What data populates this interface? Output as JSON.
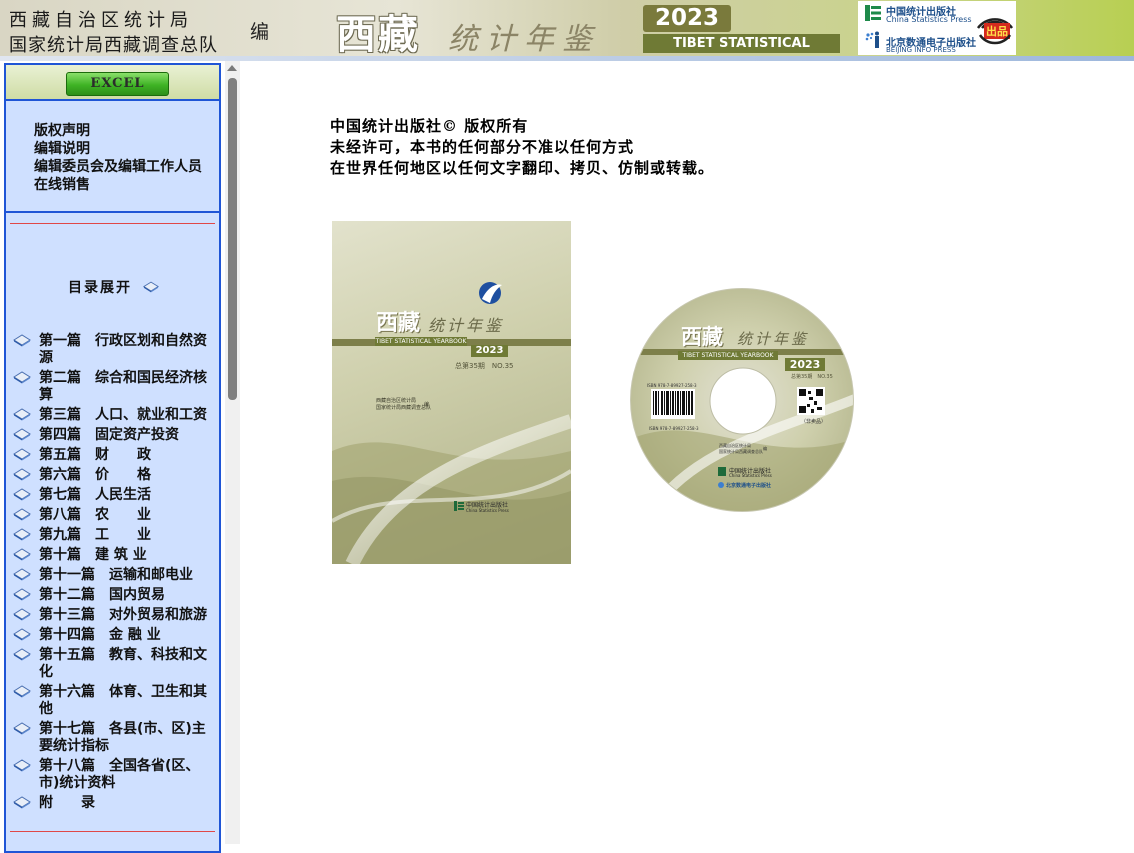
{
  "banner": {
    "org_line1": "西藏自治区统计局",
    "org_line2": "国家统计局西藏调查总队",
    "editor_tag": "编",
    "title_big": "西藏",
    "title_small": "统计年鉴",
    "year": "2023",
    "title_en": "TIBET STATISTICAL YEARBOOK",
    "press1_cn": "中国统计出版社",
    "press1_en": "China Statistics Press",
    "press2_cn": "北京数通电子出版社",
    "press2_en": "BEIJING INFO PRESS",
    "stamp_text": "出品"
  },
  "sidebar": {
    "excel_label": "EXCEL",
    "info_links": [
      "版权声明",
      "编辑说明",
      "编辑委员会及编辑工作人员",
      "在线销售"
    ],
    "toc_toggle": "目录展开",
    "toc": [
      "第一篇　行政区划和自然资源",
      "第二篇　综合和国民经济核算",
      "第三篇　人口、就业和工资",
      "第四篇　固定资产投资",
      "第五篇　财　　政",
      "第六篇　价　　格",
      "第七篇　人民生活",
      "第八篇　农　　业",
      "第九篇　工　　业",
      "第十篇　建 筑 业",
      "第十一篇　运输和邮电业",
      "第十二篇　国内贸易",
      "第十三篇　对外贸易和旅游",
      "第十四篇　金 融 业",
      "第十五篇　教育、科技和文化",
      "第十六篇　体育、卫生和其他",
      "第十七篇　各县(市、区)主要统计指标",
      "第十八篇　全国各省(区、市)统计资料",
      "附　　录"
    ]
  },
  "main": {
    "copyright_lines": [
      "中国统计出版社© 版权所有",
      "未经许可，本书的任何部分不准以任何方式",
      "在世界任何地区以任何文字翻印、拷贝、仿制或转载。"
    ],
    "cover": {
      "title_big": "西藏",
      "title_small": "统计年鉴",
      "title_en": "TIBET STATISTICAL YEARBOOK",
      "year": "2023",
      "issue": "总第35期　NO.35",
      "org1": "西藏自治区统计局",
      "org2": "国家统计局西藏调查总队",
      "editor": "编",
      "publisher": "中国统计出版社",
      "publisher_en": "China Statistics Press"
    },
    "cd": {
      "title_big": "西藏",
      "title_small": "统计年鉴",
      "title_en": "TIBET STATISTICAL YEARBOOK",
      "year": "2023",
      "issue": "总第35期　NO.35",
      "isbn_top": "ISBN 978-7-89927-258-3",
      "isbn_bottom": "ISBN 978-7-89927-258-3",
      "edition": "（非卖品）",
      "org1": "西藏自治区统计局",
      "org2": "国家统计局西藏调查总队",
      "editor": "编",
      "publisher1": "中国统计出版社",
      "publisher1_en": "China Statistics Press",
      "publisher2": "北京数通电子出版社"
    }
  },
  "colors": {
    "sidebar_bg": "#cfe0ff",
    "sidebar_border": "#1f55d6",
    "rule_red": "#e04848",
    "brand_olive": "#6f7a35"
  }
}
